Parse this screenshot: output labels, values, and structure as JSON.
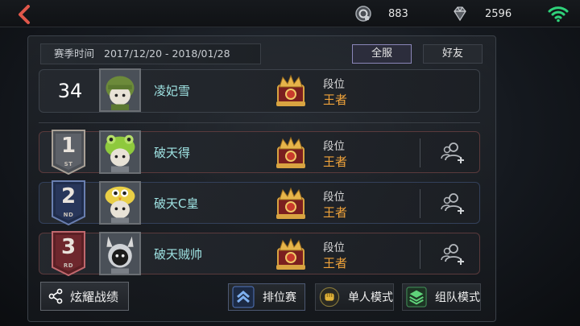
{
  "topbar": {
    "currency1": {
      "icon": "coin-icon",
      "value": "883"
    },
    "currency2": {
      "icon": "diamond-icon",
      "value": "2596"
    },
    "wifi_color": "#2fd27a",
    "back_color": "#e0574a"
  },
  "season": {
    "label": "赛季时间",
    "range": "2017/12/20 - 2018/01/28"
  },
  "tabs": [
    {
      "label": "全服",
      "active": true
    },
    {
      "label": "好友",
      "active": false
    }
  ],
  "self_row": {
    "rank": "34",
    "name": "凌妃雪",
    "tier_label": "段位",
    "tier_value": "王者"
  },
  "leaderboard": [
    {
      "place": "1",
      "suffix": "ST",
      "name": "破天得",
      "tier_label": "段位",
      "tier_value": "王者"
    },
    {
      "place": "2",
      "suffix": "ND",
      "name": "破天C皇",
      "tier_label": "段位",
      "tier_value": "王者"
    },
    {
      "place": "3",
      "suffix": "RD",
      "name": "破天贼帅",
      "tier_label": "段位",
      "tier_value": "王者"
    }
  ],
  "bottom": {
    "share_label": "炫耀战绩",
    "modes": [
      {
        "label": "排位赛",
        "icon": "ranked-chevron-icon",
        "active": true
      },
      {
        "label": "单人模式",
        "icon": "fist-icon",
        "active": false
      },
      {
        "label": "组队模式",
        "icon": "team-icon",
        "active": false
      }
    ]
  },
  "colors": {
    "name": "#9fe3e3",
    "tier": "#f0a33a",
    "accent": "#8a86b8"
  }
}
